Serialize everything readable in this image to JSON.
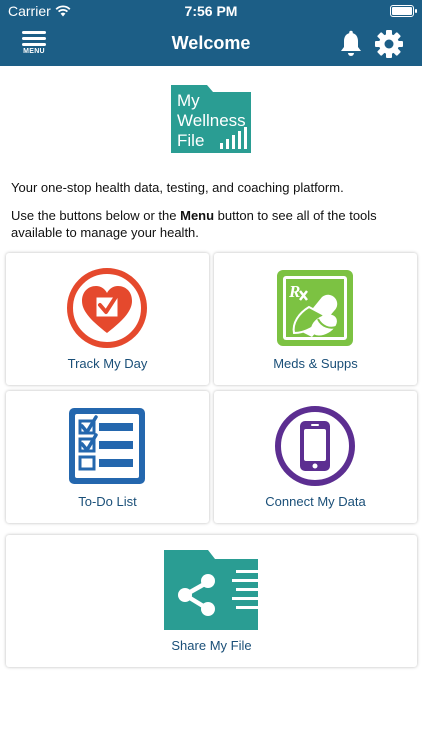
{
  "status_bar": {
    "carrier": "Carrier",
    "time": "7:56 PM"
  },
  "nav": {
    "title": "Welcome",
    "menu_label": "MENU"
  },
  "logo": {
    "line1": "My",
    "line2": "Wellness",
    "line3": "File"
  },
  "intro": {
    "line1": "Your one-stop health data, testing, and coaching platform.",
    "line2_pre": "Use the buttons below or the ",
    "line2_bold": "Menu",
    "line2_post": " button to see all of the tools available to manage your health."
  },
  "tiles": {
    "track_my_day": "Track My Day",
    "meds_supps": "Meds & Supps",
    "todo_list": "To-Do List",
    "connect_my_data": "Connect My Data",
    "share_my_file": "Share My File"
  },
  "icons": {
    "track_my_day": "heart-checkbox-icon",
    "meds_supps": "rx-pills-icon",
    "todo_list": "checklist-icon",
    "connect_my_data": "smartphone-icon",
    "share_my_file": "share-folder-icon"
  },
  "colors": {
    "header": "#1c5e86",
    "teal": "#2a9d93",
    "red": "#e5492d",
    "green": "#7cc242",
    "blue": "#2467ae",
    "purple": "#5c2e91",
    "label": "#1a4f78"
  }
}
